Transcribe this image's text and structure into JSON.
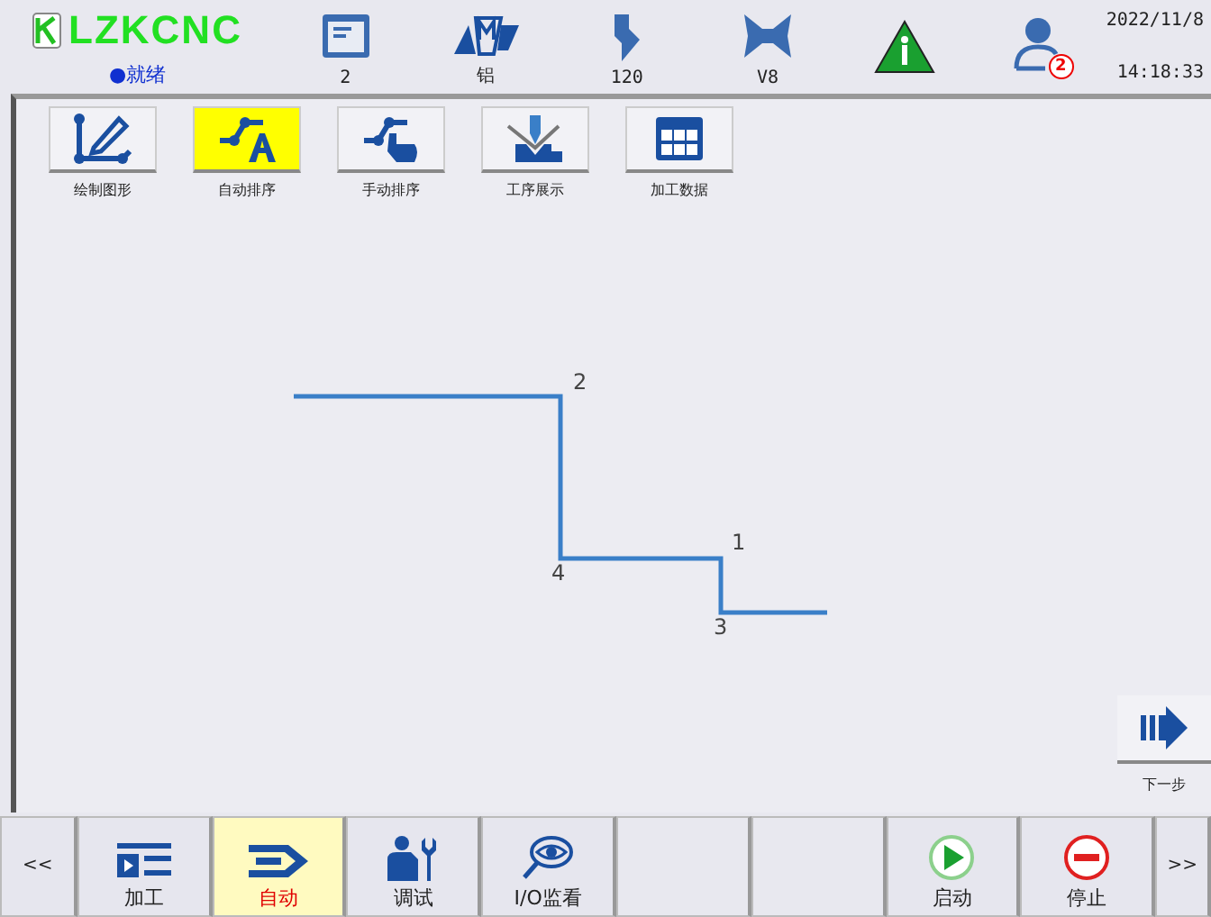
{
  "header": {
    "logo": "LZKCNC",
    "status": "●就绪",
    "items": [
      {
        "kind": "file",
        "value": "2"
      },
      {
        "kind": "material",
        "value": "铝"
      },
      {
        "kind": "punch",
        "value": "120"
      },
      {
        "kind": "die",
        "value": "V8"
      }
    ],
    "user_badge": "2",
    "date": "2022/11/8",
    "time": "14:18:33"
  },
  "toolbar": [
    {
      "kind": "draw",
      "label": "绘制图形",
      "selected": false
    },
    {
      "kind": "auto",
      "label": "自动排序",
      "selected": true
    },
    {
      "kind": "manual",
      "label": "手动排序",
      "selected": false
    },
    {
      "kind": "process",
      "label": "工序展示",
      "selected": false
    },
    {
      "kind": "data",
      "label": "加工数据",
      "selected": false
    }
  ],
  "drawing": {
    "labels": [
      "2",
      "4",
      "1",
      "3"
    ]
  },
  "next_step": {
    "label": "下一步"
  },
  "bottom_bar": {
    "prev": "<<",
    "next": ">>",
    "tabs": [
      {
        "kind": "process",
        "label": "加工",
        "selected": false
      },
      {
        "kind": "auto",
        "label": "自动",
        "selected": true
      },
      {
        "kind": "debug",
        "label": "调试",
        "selected": false
      },
      {
        "kind": "io",
        "label": "I/O监看",
        "selected": false
      }
    ],
    "start": "启动",
    "stop": "停止"
  }
}
